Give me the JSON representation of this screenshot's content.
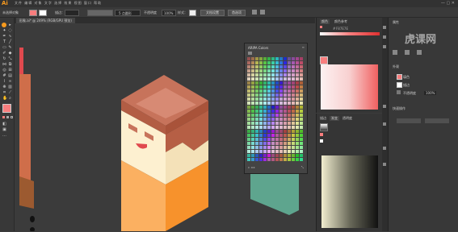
{
  "app": {
    "logo": "Ai",
    "menus": "文件 编辑 对象 文字 选择 效果 视图 窗口 帮助"
  },
  "control_bar": {
    "selection_label": "未选择对象",
    "stroke_label": "描边：",
    "style_label": "5 点圆形",
    "opacity_label": "不透明度",
    "opacity_value": "100%",
    "style2_label": "样式：",
    "doc_setup_label": "文档设置",
    "prefs_label": "首选项"
  },
  "document_tab": {
    "label": "形象.ai* @ 249% (RGB/GPU 预览)"
  },
  "swatch_panel": {
    "title": "ARIPA Colors"
  },
  "color_panel": {
    "tab1": "颜色",
    "tab2": "颜色参考",
    "hex_label": "#",
    "hex_value": "F87E7E"
  },
  "gradient_panel": {
    "tab1": "描边",
    "tab2": "渐变",
    "tab3": "透明度"
  },
  "properties_panel": {
    "title": "属性",
    "section_appearance": "外观",
    "fill_label": "填色",
    "stroke_label": "描边",
    "opacity_label": "不透明度",
    "opacity_value": "100%",
    "quick_actions": "快速操作"
  },
  "watermark": {
    "text": "虎课网"
  },
  "colors": {
    "fill": "#f87e7e",
    "accent": "#f79a1e",
    "skin": "#fdf0d0",
    "hair": "#c46a4e",
    "shirt": "#f7942e",
    "teal": "#5ea58e"
  }
}
